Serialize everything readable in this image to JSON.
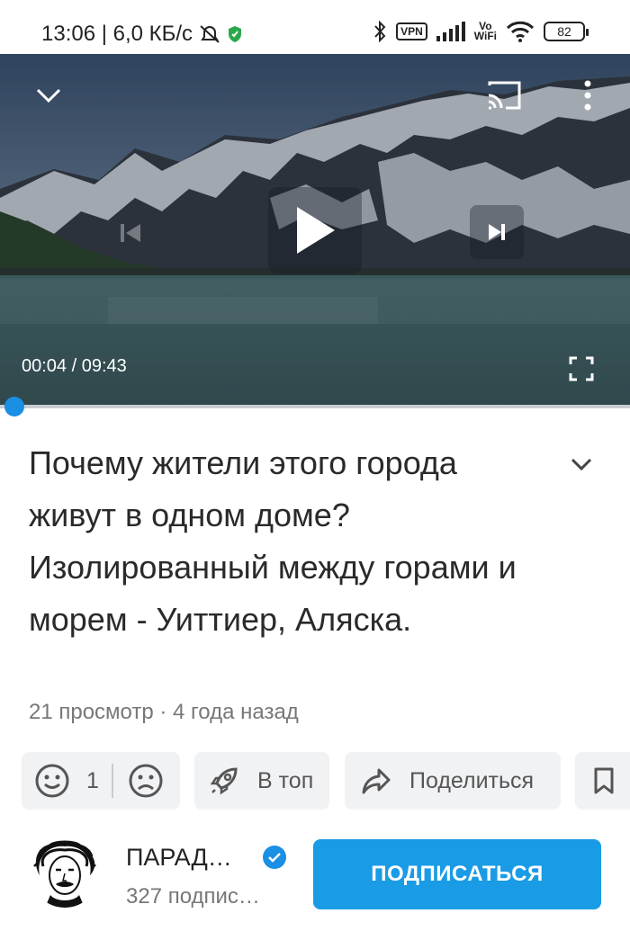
{
  "status_bar": {
    "time_and_speed": "13:06 | 6,0 КБ/с",
    "vpn_label": "VPN",
    "vowifi_top": "Vo",
    "vowifi_bottom": "WiFi",
    "battery": "82"
  },
  "player": {
    "time": "00:04 / 09:43",
    "progress": 0.007,
    "icons": [
      "chevron-down-icon",
      "cast-icon",
      "more-vert-icon",
      "skip-previous-icon",
      "play-icon",
      "skip-next-icon",
      "fullscreen-icon"
    ]
  },
  "video": {
    "title": "Почему жители этого города живут в одном доме? Изолированный между горами и морем - Уиттиер, Аляска.",
    "meta": "21 просмотр · 4 года назад"
  },
  "actions": {
    "reaction_count": "1",
    "top_label": "В топ",
    "share_label": "Поделиться"
  },
  "channel": {
    "name": "ПАРАД…",
    "subscribers": "327 подпис…",
    "subscribe_label": "ПОДПИСАТЬСЯ"
  },
  "colors": {
    "accent": "#1a9be6",
    "chip_bg": "#f1f2f4",
    "meta_text": "#777777"
  }
}
